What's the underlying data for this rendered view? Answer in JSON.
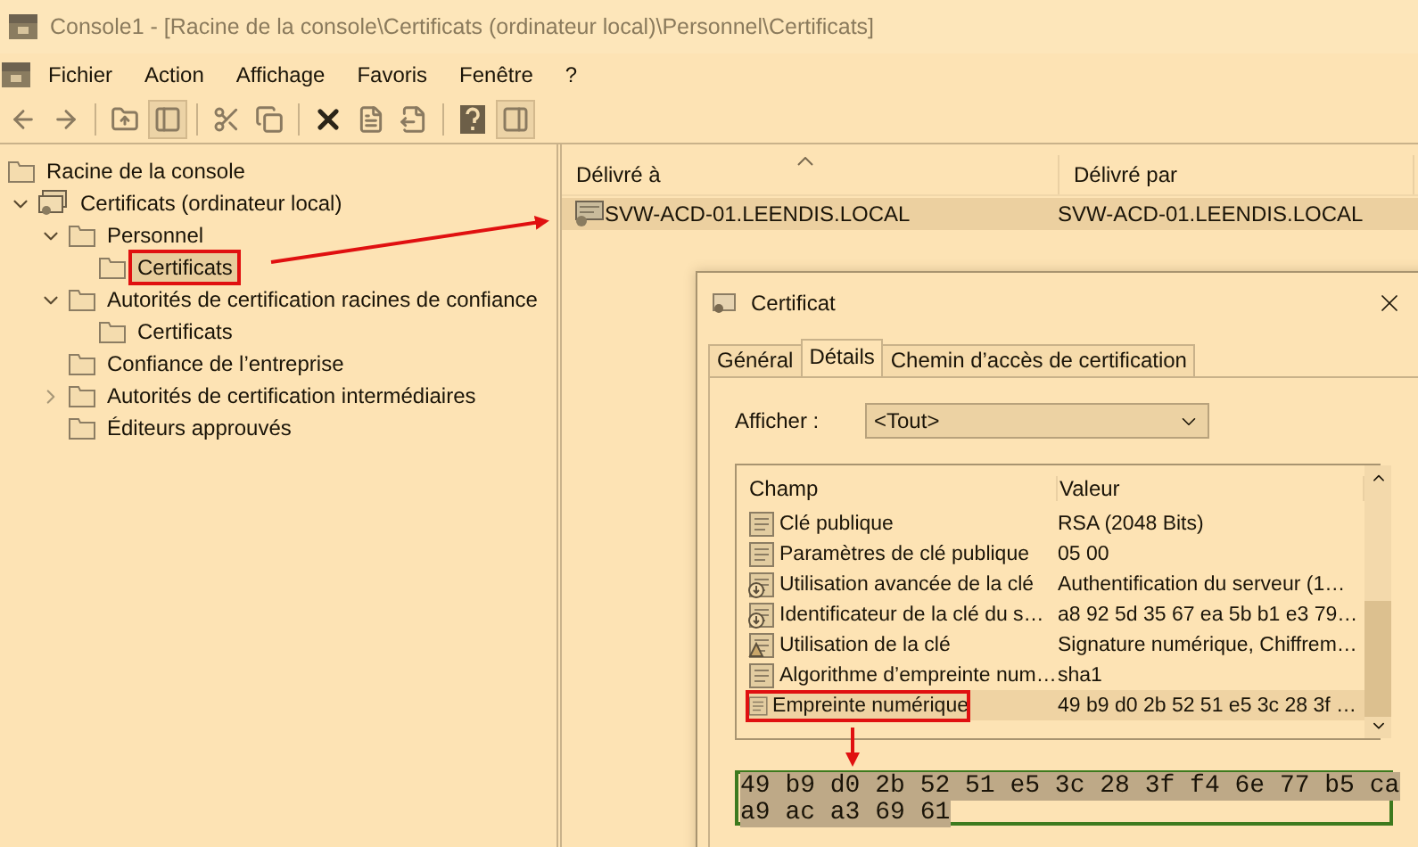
{
  "window": {
    "title": "Console1 - [Racine de la console\\Certificats (ordinateur local)\\Personnel\\Certificats]"
  },
  "menu": [
    "Fichier",
    "Action",
    "Affichage",
    "Favoris",
    "Fenêtre",
    "?"
  ],
  "toolbar": {
    "tree_pane_on": true,
    "action_pane_on": true
  },
  "tree": [
    {
      "label": "Racine de la console",
      "kind": "folder",
      "selected": false,
      "annotated": false,
      "children": [
        {
          "label": "Certificats (ordinateur local)",
          "kind": "store",
          "expanded": true,
          "selected": false,
          "annotated": false,
          "children": [
            {
              "label": "Personnel",
              "kind": "folder",
              "expanded": true,
              "selected": false,
              "annotated": false,
              "children": [
                {
                  "label": "Certificats",
                  "kind": "folder",
                  "selected": true,
                  "annotated": true
                }
              ]
            },
            {
              "label": "Autorités de certification racines de confiance",
              "kind": "folder",
              "expanded": true,
              "selected": false,
              "annotated": false,
              "children": [
                {
                  "label": "Certificats",
                  "kind": "folder",
                  "selected": false,
                  "annotated": false
                }
              ]
            },
            {
              "label": "Confiance de l’entreprise",
              "kind": "folder",
              "selected": false,
              "annotated": false
            },
            {
              "label": "Autorités de certification intermédiaires",
              "kind": "folder",
              "expanded": false,
              "selected": false,
              "annotated": false
            },
            {
              "label": "Éditeurs approuvés",
              "kind": "folder",
              "selected": false,
              "annotated": false
            }
          ]
        }
      ]
    }
  ],
  "list": {
    "columns": [
      "Délivré à",
      "Délivré par"
    ],
    "rows": [
      {
        "issued_to": "SVW-ACD-01.LEENDIS.LOCAL",
        "issued_by": "SVW-ACD-01.LEENDIS.LOCAL",
        "selected": true
      }
    ]
  },
  "dialog": {
    "title": "Certificat",
    "tabs": [
      {
        "label": "Général",
        "selected": false
      },
      {
        "label": "Détails",
        "selected": true
      },
      {
        "label": "Chemin d’accès de certification",
        "selected": false
      }
    ],
    "show_label": "Afficher :",
    "show_value": "<Tout>",
    "columns": [
      "Champ",
      "Valeur"
    ],
    "fields": [
      {
        "field": "Clé publique",
        "value": "RSA (2048 Bits)",
        "kind": "plain",
        "selected": false,
        "annotated": false
      },
      {
        "field": "Paramètres de clé publique",
        "value": "05 00",
        "kind": "plain",
        "selected": false,
        "annotated": false
      },
      {
        "field": "Utilisation avancée de la clé",
        "value": "Authentification du serveur (1…",
        "kind": "extension",
        "selected": false,
        "annotated": false
      },
      {
        "field": "Identificateur de la clé du s…",
        "value": "a8 92 5d 35 67 ea 5b b1 e3 79…",
        "kind": "extension",
        "selected": false,
        "annotated": false
      },
      {
        "field": "Utilisation de la clé",
        "value": "Signature numérique, Chiffrem…",
        "kind": "critical",
        "selected": false,
        "annotated": false
      },
      {
        "field": "Algorithme d’empreinte num…",
        "value": "sha1",
        "kind": "plain",
        "selected": false,
        "annotated": false
      },
      {
        "field": "Empreinte numérique",
        "value": "49 b9 d0 2b 52 51 e5 3c 28 3f …",
        "kind": "plain",
        "selected": true,
        "annotated": true
      }
    ],
    "detail_lines": [
      "49 b9 d0 2b 52 51 e5 3c 28 3f f4 6e 77 b5 ca",
      "a9 ac a3 69 61"
    ]
  }
}
